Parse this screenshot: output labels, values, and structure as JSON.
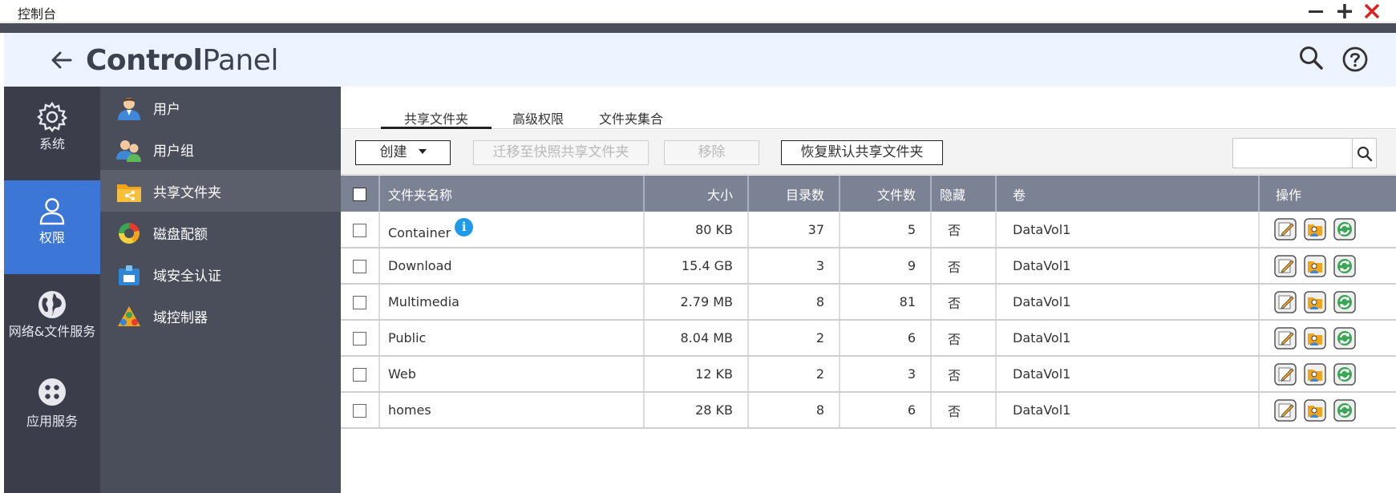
{
  "window": {
    "title": "控制台"
  },
  "header": {
    "title_bold": "Control",
    "title_light": "Panel"
  },
  "rail": [
    {
      "label": "系统",
      "icon": "gear-icon"
    },
    {
      "label": "权限",
      "icon": "user-icon"
    },
    {
      "label": "网络&文件服务",
      "icon": "globe-icon"
    },
    {
      "label": "应用服务",
      "icon": "apps-icon"
    }
  ],
  "subnav": [
    {
      "label": "用户",
      "icon": "user-icon"
    },
    {
      "label": "用户组",
      "icon": "group-icon"
    },
    {
      "label": "共享文件夹",
      "icon": "shared-folder-icon"
    },
    {
      "label": "磁盘配额",
      "icon": "quota-pie-icon"
    },
    {
      "label": "域安全认证",
      "icon": "domain-security-icon"
    },
    {
      "label": "域控制器",
      "icon": "domain-controller-icon"
    }
  ],
  "tabs": [
    "共享文件夹",
    "高级权限",
    "文件夹集合"
  ],
  "toolbar": {
    "create": "创建",
    "migrate": "迁移至快照共享文件夹",
    "remove": "移除",
    "restore": "恢复默认共享文件夹",
    "search_placeholder": ""
  },
  "table": {
    "columns": [
      "文件夹名称",
      "大小",
      "目录数",
      "文件数",
      "隐藏",
      "卷",
      "操作"
    ],
    "rows": [
      {
        "name": "Container",
        "size": "80 KB",
        "dirs": "37",
        "files": "5",
        "hidden": "否",
        "volume": "DataVol1"
      },
      {
        "name": "Download",
        "size": "15.4 GB",
        "dirs": "3",
        "files": "9",
        "hidden": "否",
        "volume": "DataVol1"
      },
      {
        "name": "Multimedia",
        "size": "2.79 MB",
        "dirs": "8",
        "files": "81",
        "hidden": "否",
        "volume": "DataVol1"
      },
      {
        "name": "Public",
        "size": "8.04 MB",
        "dirs": "2",
        "files": "6",
        "hidden": "否",
        "volume": "DataVol1"
      },
      {
        "name": "Web",
        "size": "12 KB",
        "dirs": "2",
        "files": "3",
        "hidden": "否",
        "volume": "DataVol1"
      },
      {
        "name": "homes",
        "size": "28 KB",
        "dirs": "8",
        "files": "6",
        "hidden": "否",
        "volume": "DataVol1"
      }
    ]
  },
  "colors": {
    "accent": "#3c76d6",
    "rail": "#3b3e4a",
    "subnav": "#4a4d5a",
    "table_header": "#7b8294"
  }
}
